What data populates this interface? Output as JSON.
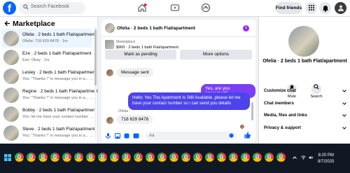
{
  "header": {
    "logo": "f",
    "search_placeholder": "Search Facebook",
    "find_friends": "Find friends",
    "icons": [
      "home-icon",
      "video-icon",
      "groups-icon",
      "menu-grid-icon",
      "messenger-icon",
      "bell-icon",
      "profile-icon"
    ]
  },
  "sidebar": {
    "title": "Marketplace",
    "conversations": [
      {
        "title": "Ofelia · 2 beds 1 bath Flat/apartment",
        "preview": "Ofelia: 718 629 8478 · 1m"
      },
      {
        "title": "Eze · 2 beds 1 bath Flat/apartment",
        "preview": "Eze: Okay · 1m"
      },
      {
        "title": "Lesley · 2 beds 1 bath Flat/apartment",
        "preview": "You: \"Thanks !\" \\n message you in a... · 1m"
      },
      {
        "title": "Regine · 2 beds 1 bath Flat/apartment",
        "preview": "You: \"Thanks !\" \\n message you in a... · 1m"
      },
      {
        "title": "Bobby · 2 beds 1 bath Flat/apartment",
        "preview": "You: let me have your contact number s... · 1m"
      },
      {
        "title": "Steve · 2 beds 1 bath Flat/apartment",
        "preview": "You: \"Thanks !\" \\n message you in a... · 1m"
      }
    ]
  },
  "chat": {
    "title": "Ofelia · 2 beds 1 bath Flat/apartment",
    "listing_label": "Marketplace",
    "listing_price": "$900 · 2 beds 1 bath Flat/apartment",
    "mark_pending": "Mark as pending",
    "more_options": "More options",
    "messages": {
      "system": "Message sent",
      "out1": "Yes, are you interested?",
      "out2": "Hello: Yes The Apartment Is Still Available ,please let me have your contact number so i can send you details",
      "sender": "Ofelia",
      "in1": "718 629 8478"
    },
    "composer_placeholder": "Aa"
  },
  "right_panel": {
    "title": "Ofelia · 2 beds 1 bath Flat/apartment",
    "mute": "Mute",
    "search": "Search",
    "items": [
      "Customize chat",
      "Chat members",
      "Media, files and links",
      "Privacy & support"
    ]
  },
  "taskbar": {
    "time": "8:20 PM",
    "date": "8/7/2025",
    "app_count": 23
  },
  "colors": {
    "brand": "#0866ff",
    "outgoing": "#7a3ff5",
    "outgoing_dark": "#4d43e8",
    "taskbar": "#101824"
  }
}
